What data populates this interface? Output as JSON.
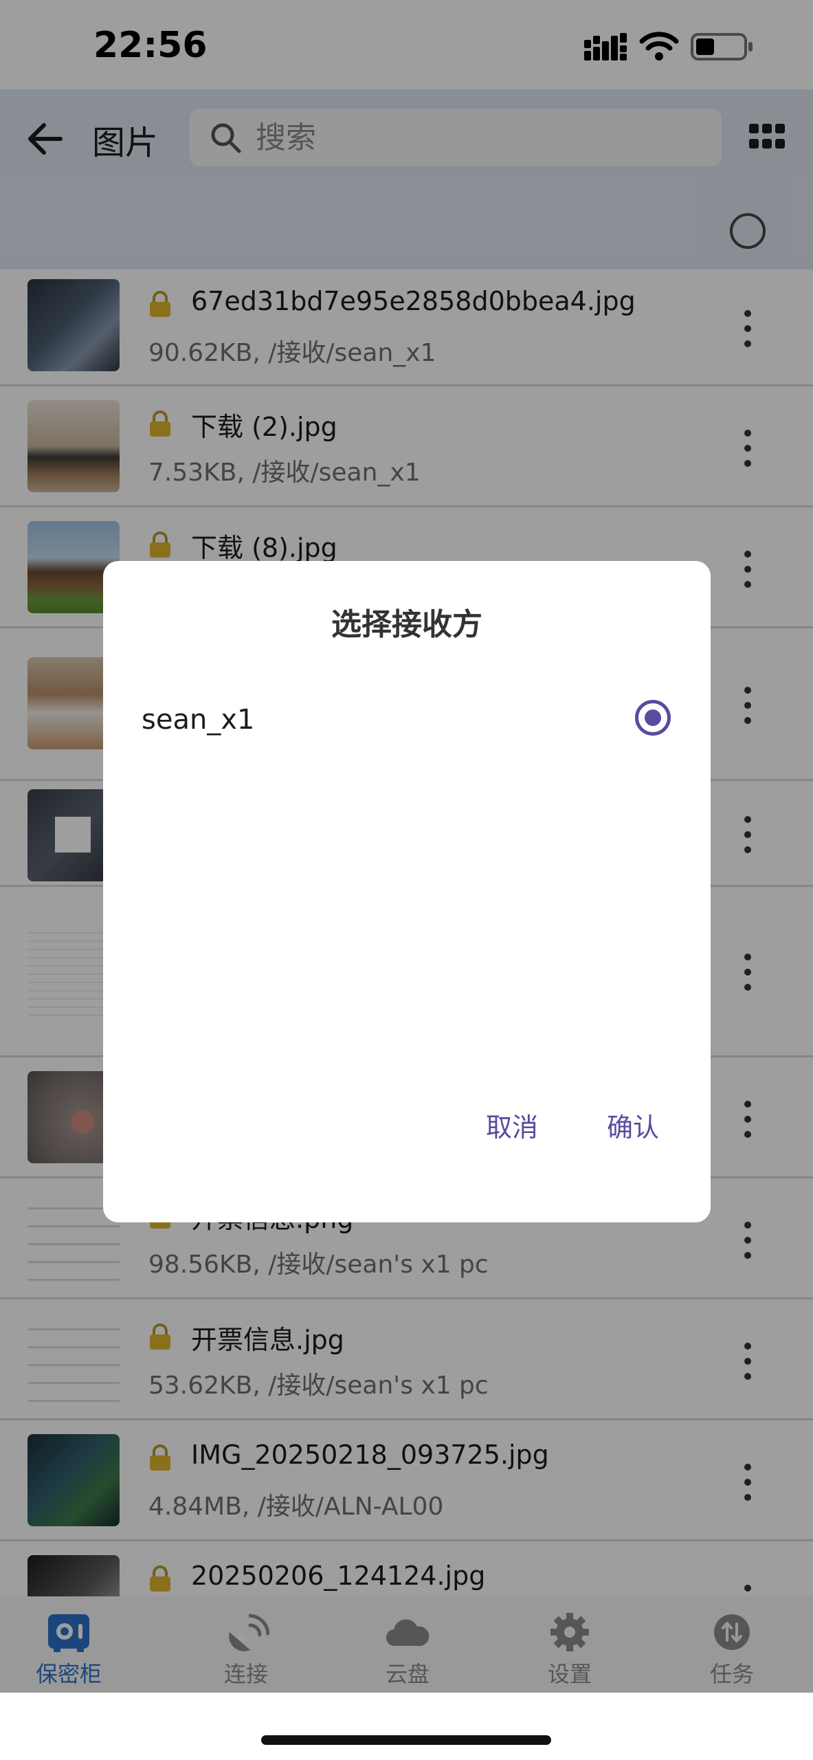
{
  "status_bar": {
    "time": "22:56"
  },
  "app_bar": {
    "title": "图片",
    "search_placeholder": "搜索"
  },
  "files": [
    {
      "name": "67ed31bd7e95e2858d0bbea4.jpg",
      "meta": "90.62KB, /接收/sean_x1"
    },
    {
      "name": "下载 (2).jpg",
      "meta": "7.53KB, /接收/sean_x1"
    },
    {
      "name": "下载 (8).jpg",
      "meta": ""
    },
    {
      "name": "",
      "meta": ""
    },
    {
      "name": "",
      "meta": ""
    },
    {
      "name": "",
      "meta": ""
    },
    {
      "name": "",
      "meta": ""
    },
    {
      "name": "开票信息.png",
      "meta": "98.56KB, /接收/sean's x1 pc"
    },
    {
      "name": "开票信息.jpg",
      "meta": "53.62KB, /接收/sean's x1 pc"
    },
    {
      "name": "IMG_20250218_093725.jpg",
      "meta": "4.84MB, /接收/ALN-AL00"
    },
    {
      "name": "20250206_124124.jpg",
      "meta": ""
    }
  ],
  "bottom_nav": [
    {
      "label": "保密柜",
      "icon": "safe-icon",
      "active": true
    },
    {
      "label": "连接",
      "icon": "satellite-icon",
      "active": false
    },
    {
      "label": "云盘",
      "icon": "cloud-icon",
      "active": false
    },
    {
      "label": "设置",
      "icon": "gear-icon",
      "active": false
    },
    {
      "label": "任务",
      "icon": "transfer-icon",
      "active": false
    }
  ],
  "dialog": {
    "title": "选择接收方",
    "option": "sean_x1",
    "cancel": "取消",
    "confirm": "确认"
  },
  "colors": {
    "accent": "#5a4aa0",
    "nav_active": "#2c72c8",
    "app_bar": "#dde6f0"
  }
}
